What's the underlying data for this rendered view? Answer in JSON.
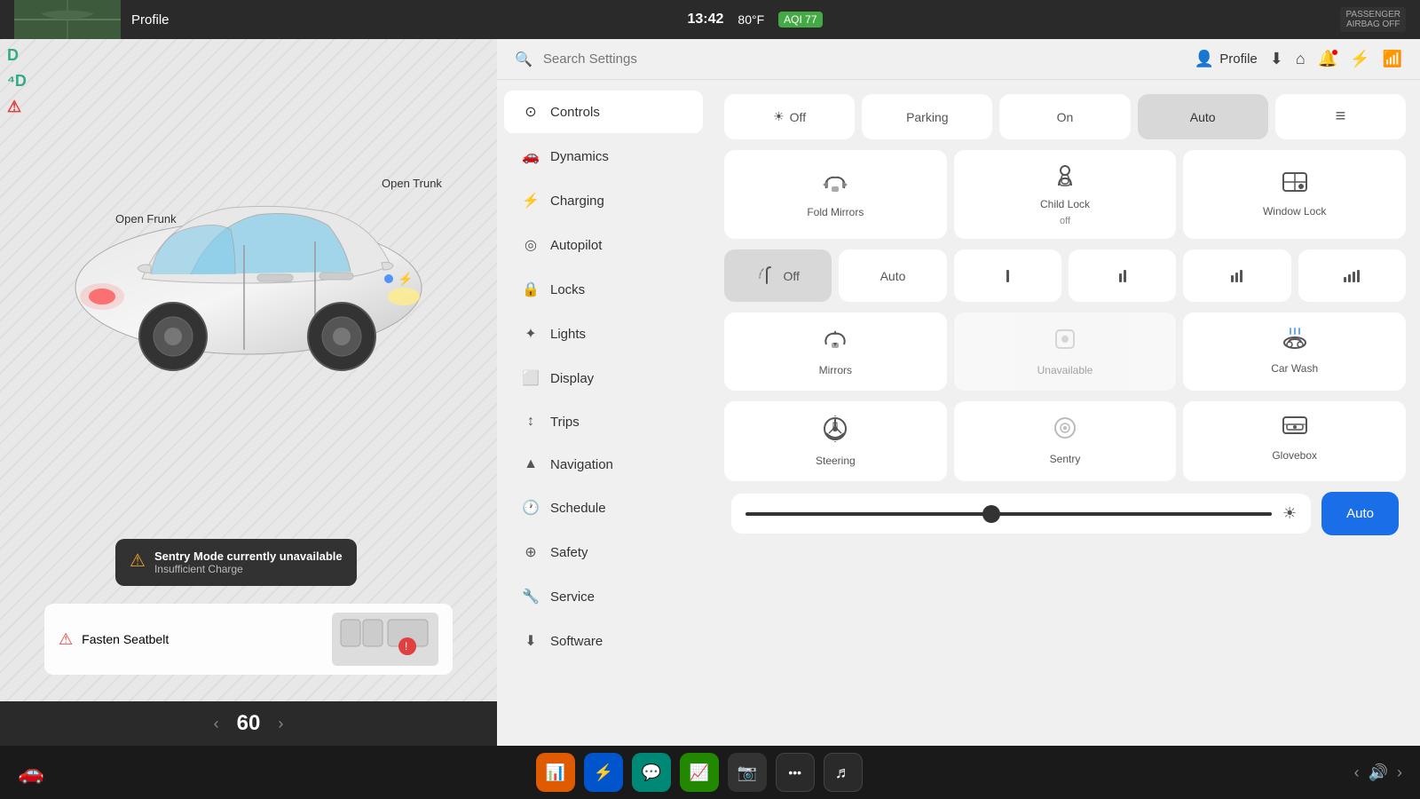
{
  "topbar": {
    "profile_label": "Profile",
    "time": "13:42",
    "temp": "80°F",
    "aqi": "AQI 77",
    "passenger_airbag": "PASSENGER\nAIRBAG OFF"
  },
  "left_panel": {
    "open_frunk": "Open\nFrunk",
    "open_trunk": "Open\nTrunk",
    "sentry_title": "Sentry Mode currently unavailable",
    "sentry_sub": "Insufficient Charge",
    "seatbelt_label": "Fasten Seatbelt",
    "speed": "60"
  },
  "search": {
    "placeholder": "Search Settings"
  },
  "nav": {
    "items": [
      {
        "id": "controls",
        "icon": "⊙",
        "label": "Controls",
        "active": true
      },
      {
        "id": "dynamics",
        "icon": "🚗",
        "label": "Dynamics",
        "active": false
      },
      {
        "id": "charging",
        "icon": "⚡",
        "label": "Charging",
        "active": false
      },
      {
        "id": "autopilot",
        "icon": "◎",
        "label": "Autopilot",
        "active": false
      },
      {
        "id": "locks",
        "icon": "🔒",
        "label": "Locks",
        "active": false
      },
      {
        "id": "lights",
        "icon": "✦",
        "label": "Lights",
        "active": false
      },
      {
        "id": "display",
        "icon": "⬜",
        "label": "Display",
        "active": false
      },
      {
        "id": "trips",
        "icon": "↕",
        "label": "Trips",
        "active": false
      },
      {
        "id": "navigation",
        "icon": "▲",
        "label": "Navigation",
        "active": false
      },
      {
        "id": "schedule",
        "icon": "🕐",
        "label": "Schedule",
        "active": false
      },
      {
        "id": "safety",
        "icon": "⊕",
        "label": "Safety",
        "active": false
      },
      {
        "id": "service",
        "icon": "🔧",
        "label": "Service",
        "active": false
      },
      {
        "id": "software",
        "icon": "⬇",
        "label": "Software",
        "active": false
      }
    ]
  },
  "controls": {
    "lights_row": {
      "buttons": [
        {
          "id": "off",
          "icon": "☀",
          "label": "Off",
          "active": false
        },
        {
          "id": "parking",
          "label": "Parking",
          "active": false
        },
        {
          "id": "on",
          "label": "On",
          "active": false
        },
        {
          "id": "auto",
          "label": "Auto",
          "active": true
        },
        {
          "id": "beams",
          "icon": "≡",
          "label": "",
          "active": false
        }
      ]
    },
    "locks_row": {
      "fold_mirrors": "Fold Mirrors",
      "child_lock": "Child Lock",
      "child_lock_sub": "off",
      "window_lock": "Window\nLock"
    },
    "wipers_row": {
      "buttons": [
        {
          "id": "off",
          "label": "Off",
          "active": true
        },
        {
          "id": "auto",
          "label": "Auto",
          "active": false
        },
        {
          "id": "1",
          "label": "I",
          "active": false
        },
        {
          "id": "2",
          "label": "II",
          "active": false
        },
        {
          "id": "3",
          "label": "III",
          "active": false
        },
        {
          "id": "4",
          "label": "IIII",
          "active": false
        }
      ]
    },
    "bottom_cards": {
      "mirrors": "Mirrors",
      "unavailable": "Unavailable",
      "car_wash": "Car Wash",
      "steering": "Steering",
      "sentry": "Sentry",
      "glovebox": "Glovebox"
    },
    "brightness_auto": "Auto"
  },
  "taskbar": {
    "apps": [
      {
        "id": "stats",
        "icon": "📊",
        "color": "orange"
      },
      {
        "id": "bluetooth",
        "icon": "⚡",
        "color": "blue"
      },
      {
        "id": "messages",
        "icon": "💬",
        "color": "teal"
      },
      {
        "id": "stocks",
        "icon": "📈",
        "color": "green"
      },
      {
        "id": "camera",
        "icon": "📷",
        "color": "dark"
      },
      {
        "id": "more",
        "icon": "•••",
        "color": "dark2"
      },
      {
        "id": "music",
        "icon": "♪",
        "color": "dark2"
      }
    ],
    "volume_icon": "🔊"
  }
}
